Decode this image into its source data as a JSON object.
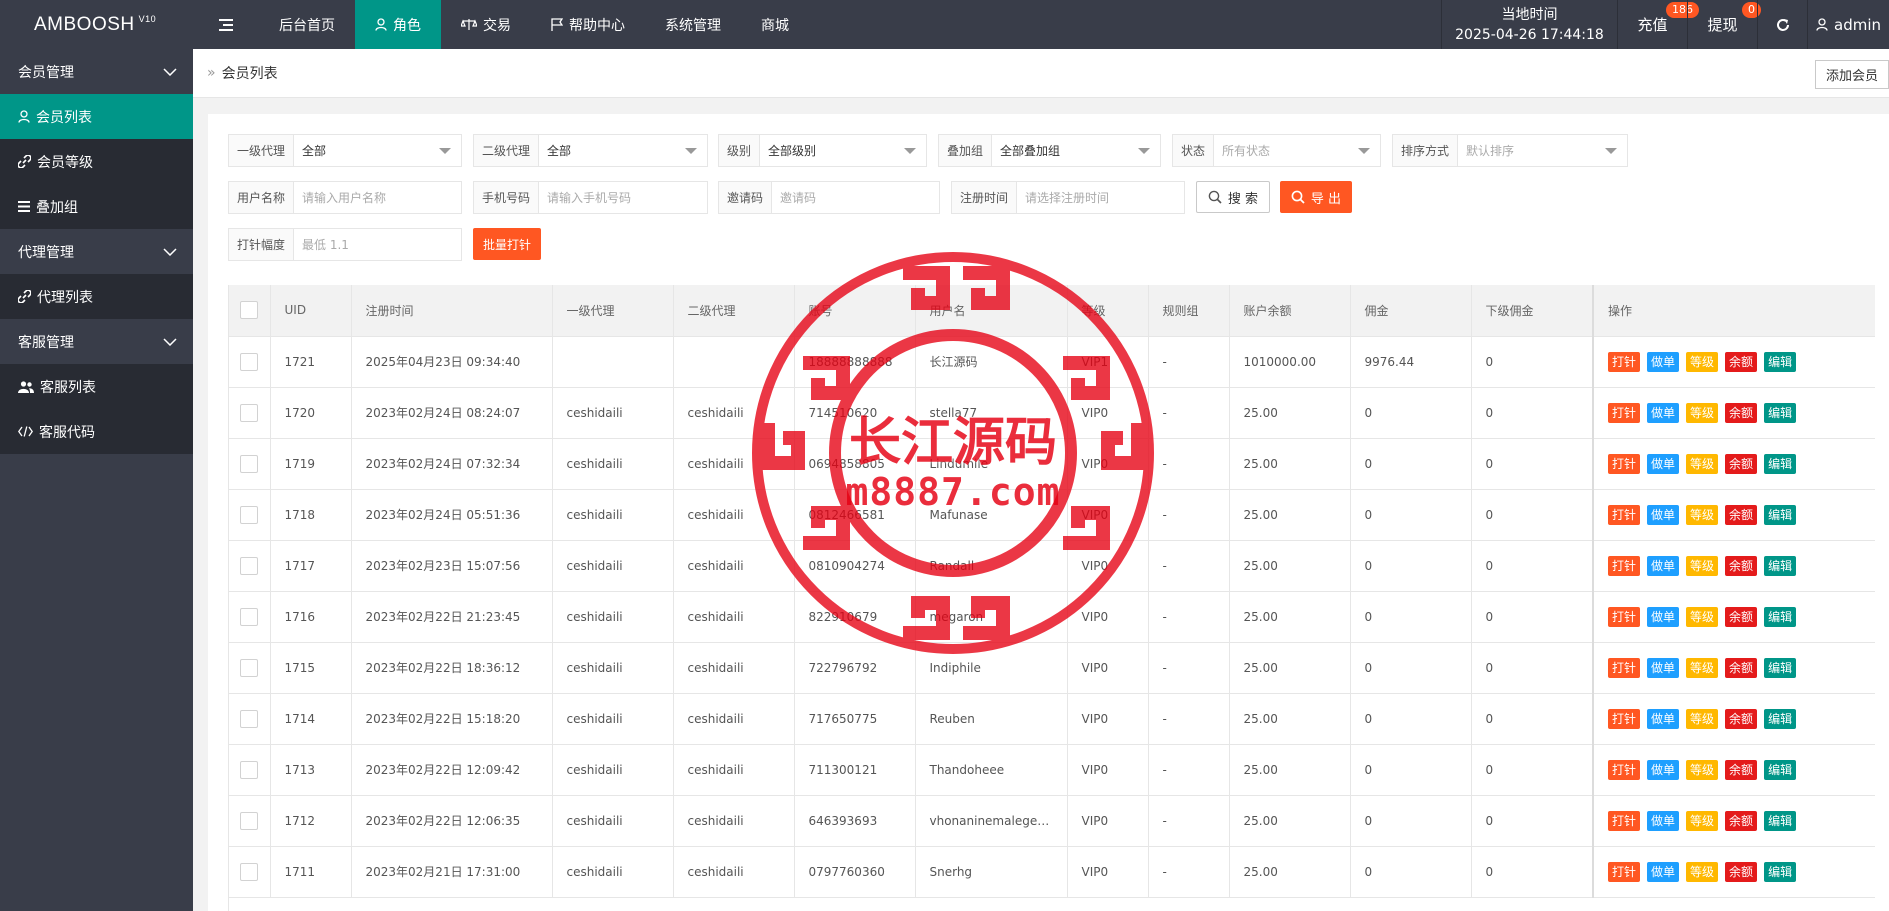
{
  "app": {
    "logo": "AMBOOSH",
    "version": "V10"
  },
  "topnav": {
    "items": [
      {
        "label": "后台首页",
        "icon": ""
      },
      {
        "label": "角色",
        "icon": "user-icon",
        "active": true
      },
      {
        "label": "交易",
        "icon": "scale-icon"
      },
      {
        "label": "帮助中心",
        "icon": "flag-icon"
      },
      {
        "label": "系统管理",
        "icon": ""
      },
      {
        "label": "商城",
        "icon": ""
      }
    ],
    "time_label": "当地时间",
    "time_value": "2025-04-26 17:44:18",
    "recharge": {
      "label": "充值",
      "badge": "186"
    },
    "withdraw": {
      "label": "提现",
      "badge": "0"
    },
    "admin": "admin"
  },
  "sidebar": {
    "groups": [
      {
        "label": "会员管理",
        "items": [
          {
            "label": "会员列表",
            "icon": "user-icon",
            "active": true
          },
          {
            "label": "会员等级",
            "icon": "link-icon"
          },
          {
            "label": "叠加组",
            "icon": "list-icon"
          }
        ]
      },
      {
        "label": "代理管理",
        "items": [
          {
            "label": "代理列表",
            "icon": "link-icon"
          }
        ]
      },
      {
        "label": "客服管理",
        "items": [
          {
            "label": "客服列表",
            "icon": "users-icon"
          },
          {
            "label": "客服代码",
            "icon": "code-icon"
          }
        ]
      }
    ]
  },
  "breadcrumb": {
    "current": "会员列表",
    "add_button": "添加会员"
  },
  "filters": {
    "agent1": {
      "label": "一级代理",
      "value": "全部"
    },
    "agent2": {
      "label": "二级代理",
      "value": "全部"
    },
    "level": {
      "label": "级别",
      "value": "全部级别"
    },
    "overlay": {
      "label": "叠加组",
      "value": "全部叠加组"
    },
    "status": {
      "label": "状态",
      "placeholder": "所有状态"
    },
    "sort": {
      "label": "排序方式",
      "placeholder": "默认排序"
    },
    "username": {
      "label": "用户名称",
      "placeholder": "请输入用户名称"
    },
    "phone": {
      "label": "手机号码",
      "placeholder": "请输入手机号码"
    },
    "invite": {
      "label": "邀请码",
      "placeholder": "邀请码"
    },
    "regtime": {
      "label": "注册时间",
      "placeholder": "请选择注册时间"
    },
    "search_button": "搜 索",
    "export_button": "导 出",
    "amplitude": {
      "label": "打针幅度",
      "placeholder": "最低 1.1"
    },
    "batch_button": "批量打针"
  },
  "table": {
    "columns": [
      "UID",
      "注册时间",
      "一级代理",
      "二级代理",
      "账号",
      "用户名",
      "等级",
      "规则组",
      "账户余额",
      "佣金",
      "下级佣金",
      "操作"
    ],
    "action_buttons": [
      {
        "label": "打针",
        "color": "#ff5722"
      },
      {
        "label": "做单",
        "color": "#1e9fff"
      },
      {
        "label": "等级",
        "color": "#ffb800"
      },
      {
        "label": "余额",
        "color": "#e41b1b"
      },
      {
        "label": "编辑",
        "color": "#009688"
      }
    ],
    "rows": [
      [
        "1721",
        "2025年04月23日 09:34:40",
        "",
        "",
        "18888888888",
        "长江源码",
        "VIP1",
        "-",
        "1010000.00",
        "9976.44",
        "0"
      ],
      [
        "1720",
        "2023年02月24日 08:24:07",
        "ceshidaili",
        "ceshidaili",
        "714510620",
        "stella77",
        "VIP0",
        "-",
        "25.00",
        "0",
        "0"
      ],
      [
        "1719",
        "2023年02月24日 07:32:34",
        "ceshidaili",
        "ceshidaili",
        "0694858805",
        "Lindumile",
        "VIP0",
        "-",
        "25.00",
        "0",
        "0"
      ],
      [
        "1718",
        "2023年02月24日 05:51:36",
        "ceshidaili",
        "ceshidaili",
        "0812466581",
        "Mafunase",
        "VIP0",
        "-",
        "25.00",
        "0",
        "0"
      ],
      [
        "1717",
        "2023年02月23日 15:07:56",
        "ceshidaili",
        "ceshidaili",
        "0810904274",
        "Randall",
        "VIP0",
        "-",
        "25.00",
        "0",
        "0"
      ],
      [
        "1716",
        "2023年02月22日 21:23:45",
        "ceshidaili",
        "ceshidaili",
        "822910679",
        "megaron",
        "VIP0",
        "-",
        "25.00",
        "0",
        "0"
      ],
      [
        "1715",
        "2023年02月22日 18:36:12",
        "ceshidaili",
        "ceshidaili",
        "722796792",
        "Indiphile",
        "VIP0",
        "-",
        "25.00",
        "0",
        "0"
      ],
      [
        "1714",
        "2023年02月22日 15:18:20",
        "ceshidaili",
        "ceshidaili",
        "717650775",
        "Reuben",
        "VIP0",
        "-",
        "25.00",
        "0",
        "0"
      ],
      [
        "1713",
        "2023年02月22日 12:09:42",
        "ceshidaili",
        "ceshidaili",
        "711300121",
        "Thandoheee",
        "VIP0",
        "-",
        "25.00",
        "0",
        "0"
      ],
      [
        "1712",
        "2023年02月22日 12:06:35",
        "ceshidaili",
        "ceshidaili",
        "646393693",
        "vhonaninemalegen...",
        "VIP0",
        "-",
        "25.00",
        "0",
        "0"
      ],
      [
        "1711",
        "2023年02月21日 17:31:00",
        "ceshidaili",
        "ceshidaili",
        "0797760360",
        "Snerhg",
        "VIP0",
        "-",
        "25.00",
        "0",
        "0"
      ]
    ]
  },
  "watermark": {
    "title": "长江源码",
    "url": "m8887.com",
    "color": "#e60012"
  }
}
